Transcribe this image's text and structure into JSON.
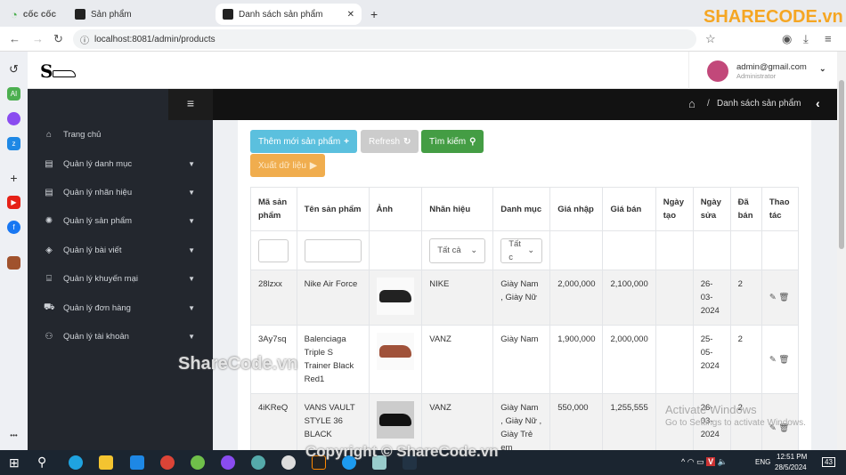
{
  "browser": {
    "brand": "cốc cốc",
    "tabs": [
      {
        "label": "Sản phẩm"
      },
      {
        "label": "Danh sách sản phẩm",
        "active": true
      }
    ],
    "url": "localhost:8081/admin/products"
  },
  "header": {
    "user_email": "admin@gmail.com",
    "user_role": "Administrator",
    "breadcrumb": "Danh sách sản phẩm"
  },
  "sidebar": {
    "items": [
      {
        "label": "Trang chủ",
        "icon": "home-icon"
      },
      {
        "label": "Quản lý danh mục",
        "icon": "table-icon"
      },
      {
        "label": "Quản lý nhãn hiệu",
        "icon": "table-icon"
      },
      {
        "label": "Quản lý sản phẩm",
        "icon": "loader-icon"
      },
      {
        "label": "Quản lý bài viết",
        "icon": "box-icon"
      },
      {
        "label": "Quản lý khuyến mại",
        "icon": "gift-icon"
      },
      {
        "label": "Quản lý đơn hàng",
        "icon": "cart-icon"
      },
      {
        "label": "Quản lý tài khoản",
        "icon": "users-icon"
      }
    ]
  },
  "toolbar": {
    "add": "Thêm mới sản phẩm",
    "refresh": "Refresh",
    "search": "Tìm kiếm",
    "export": "Xuất dữ liệu"
  },
  "colors": {
    "add": "#5bc0de",
    "refresh": "#cccccc",
    "search": "#449d44",
    "export": "#f0ad4e"
  },
  "table": {
    "headers": [
      "Mã sản phẩm",
      "Tên sản phẩm",
      "Ảnh",
      "Nhãn hiệu",
      "Danh mục",
      "Giá nhập",
      "Giá bán",
      "Ngày tạo",
      "Ngày sửa",
      "Đã bán",
      "Thao tác"
    ],
    "filters": {
      "brand": "Tất cả",
      "category": "Tất c"
    },
    "rows": [
      {
        "code": "28lzxx",
        "name": "Nike Air Force",
        "brand": "NIKE",
        "category": "Giày Nam , Giày Nữ",
        "import_price": "2,000,000",
        "price": "2,100,000",
        "created": "",
        "updated": "26-03-2024",
        "sold": "2"
      },
      {
        "code": "3Ay7sq",
        "name": "Balenciaga Triple S Trainer Black Red1",
        "brand": "VANZ",
        "category": "Giày Nam",
        "import_price": "1,900,000",
        "price": "2,000,000",
        "created": "",
        "updated": "25-05-2024",
        "sold": "2"
      },
      {
        "code": "4iKReQ",
        "name": "VANS VAULT STYLE 36 BLACK",
        "brand": "VANZ",
        "category": "Giày Nam , Giày Nữ , Giày Trẻ em",
        "import_price": "550,000",
        "price": "1,255,555",
        "created": "",
        "updated": "26-03-2024",
        "sold": "2"
      }
    ]
  },
  "overlay": {
    "activate_title": "Activate Windows",
    "activate_sub": "Go to Settings to activate Windows.",
    "watermark": "ShareCode.vn",
    "copyright": "Copyright © ShareCode.vn",
    "logo": "SHARECODE.vn"
  },
  "taskbar": {
    "time": "12:51 PM",
    "date": "28/5/2024",
    "lang": "ENG",
    "notif": "43"
  }
}
